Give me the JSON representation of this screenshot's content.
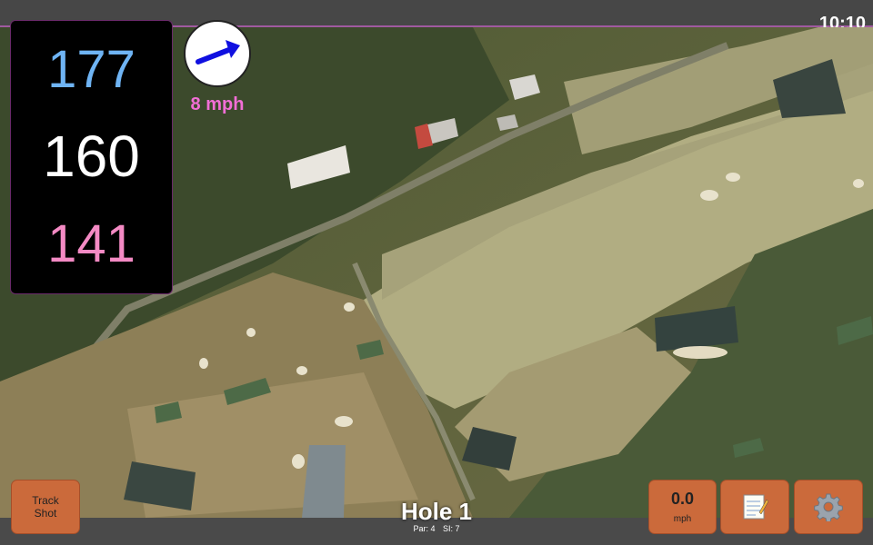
{
  "status": {
    "time": "10:10"
  },
  "distances": {
    "back": "177",
    "middle": "160",
    "front": "141"
  },
  "wind": {
    "speed": "8 mph",
    "icon": "wind-arrow-icon"
  },
  "buttons": {
    "track_shot_line1": "Track",
    "track_shot_line2": "Shot",
    "speed_value": "0.0",
    "speed_unit": "mph",
    "notes_icon": "notepad-icon",
    "settings_icon": "gear-icon"
  },
  "hole": {
    "title": "Hole 1",
    "par": "Par: 4",
    "si": "SI: 7"
  },
  "colors": {
    "button": "#cb6a3b",
    "back_distance": "#6fb4f4",
    "front_distance": "#f48ac4",
    "wind_text": "#f26ed6"
  }
}
